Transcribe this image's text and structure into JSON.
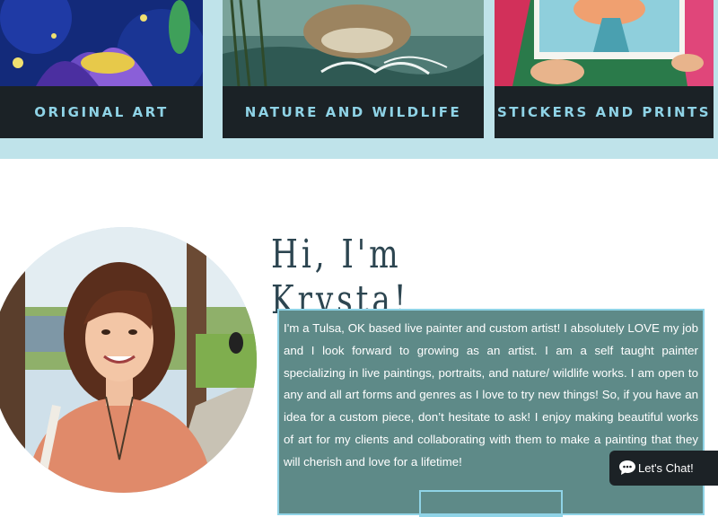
{
  "categories": [
    {
      "label": "ORIGINAL ART"
    },
    {
      "label": "NATURE AND WILDLIFE"
    },
    {
      "label": "STICKERS AND PRINTS"
    }
  ],
  "about": {
    "title": "Hi, I'm Krysta!",
    "bio": "I'm a Tulsa, OK based live painter and custom artist! I absolutely LOVE my job and I look forward to growing as an artist. I am a self taught painter specializing in live paintings, portraits, and nature/ wildlife works. I am open to any and all art forms and genres as I love to try new things! So, if you have an idea for a custom piece, don’t hesitate to ask! I enjoy making beautiful works of art for my clients and collaborating with them to make a painting that they will cherish and love for a lifetime!"
  },
  "chat": {
    "label": "Let's Chat!"
  },
  "colors": {
    "band": "#bfe3ea",
    "card": "#1b2226",
    "accent": "#8fd3e6",
    "bio_box": "#5e8a88"
  }
}
